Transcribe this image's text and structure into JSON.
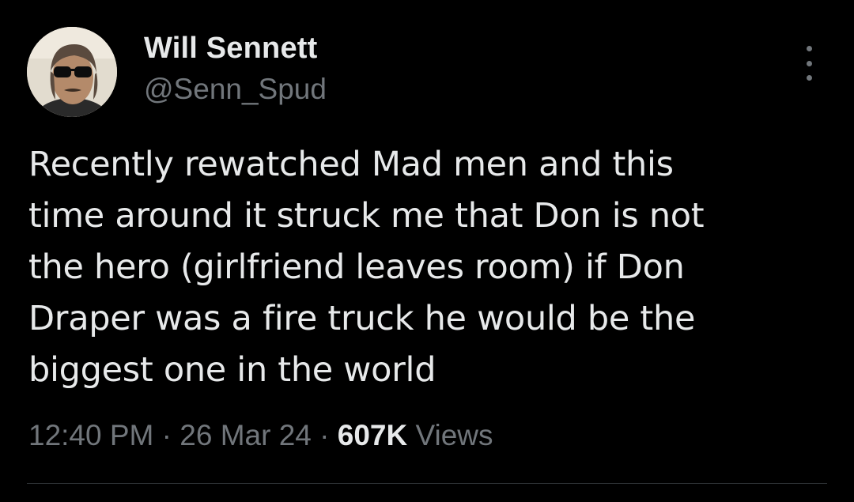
{
  "user": {
    "display_name": "Will Sennett",
    "handle": "@Senn_Spud"
  },
  "tweet": {
    "lines": [
      "Recently rewatched Mad men and this",
      "time around it struck me that Don is not",
      "the hero (girlfriend leaves room) if Don",
      "Draper was a fire truck he would be the",
      "biggest one in the world"
    ],
    "time": "12:40 PM",
    "separator": "·",
    "date": "26 Mar 24",
    "views_count": "607K",
    "views_label": "Views"
  },
  "icons": {
    "more": "more-options-icon",
    "avatar": "user-avatar"
  },
  "colors": {
    "background": "#000000",
    "primary_text": "#e7e9ea",
    "secondary_text": "#71767b",
    "divider": "#2f3336"
  }
}
